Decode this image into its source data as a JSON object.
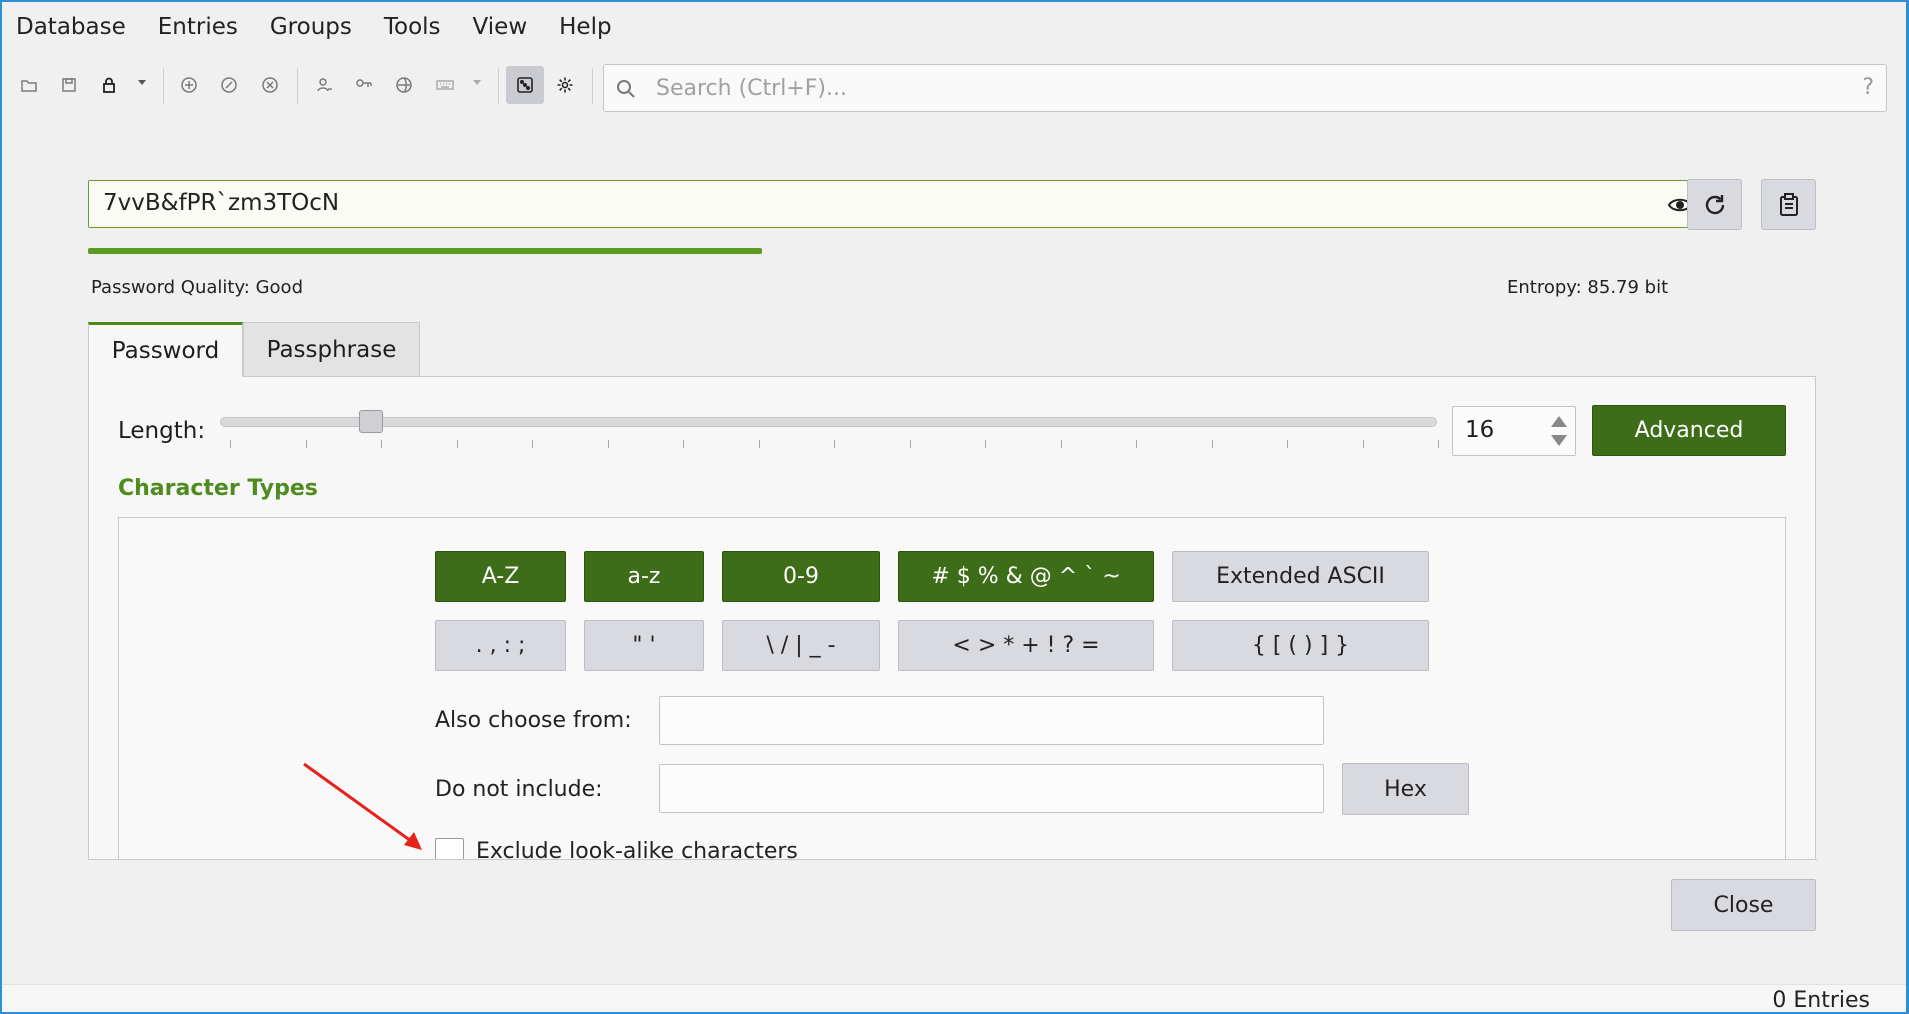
{
  "menubar": {
    "items": [
      "Database",
      "Entries",
      "Groups",
      "Tools",
      "View",
      "Help"
    ]
  },
  "toolbar": {
    "icons": [
      "open-database-icon",
      "save-database-icon",
      "lock-database-icon",
      "add-entry-icon",
      "edit-entry-icon",
      "delete-entry-icon",
      "copy-username-icon",
      "copy-password-icon",
      "copy-url-icon",
      "autotype-icon",
      "password-generator-icon",
      "settings-icon"
    ]
  },
  "search": {
    "placeholder": "Search (Ctrl+F)...",
    "help": "?"
  },
  "generator": {
    "password": "7vvB&fPR`zm3TOcN",
    "quality_label": "Password Quality: Good",
    "entropy_label": "Entropy: 85.79 bit",
    "quality_fraction": 0.39,
    "tabs": [
      "Password",
      "Passphrase"
    ],
    "length_label": "Length:",
    "length_value": "16",
    "advanced_label": "Advanced",
    "character_types_title": "Character Types",
    "char_buttons_row1": [
      "A-Z",
      "a-z",
      "0-9",
      "# $ % & @ ^ ` ~",
      "Extended ASCII"
    ],
    "char_buttons_row2": [
      ". , : ;",
      "\" '",
      "\\ / | _ -",
      "< > * + ! ? =",
      "{ [ ( ) ] }"
    ],
    "also_choose_label": "Also choose from:",
    "do_not_include_label": "Do not include:",
    "hex_label": "Hex",
    "exclude_lookalike_label": "Exclude look-alike characters",
    "close_label": "Close"
  },
  "status": {
    "entries": "0 Entries"
  },
  "colors": {
    "accent_green": "#3e6d19",
    "quality_green": "#5b9b22",
    "section_green": "#4f8c20",
    "annotation_arrow": "#e8221b"
  }
}
